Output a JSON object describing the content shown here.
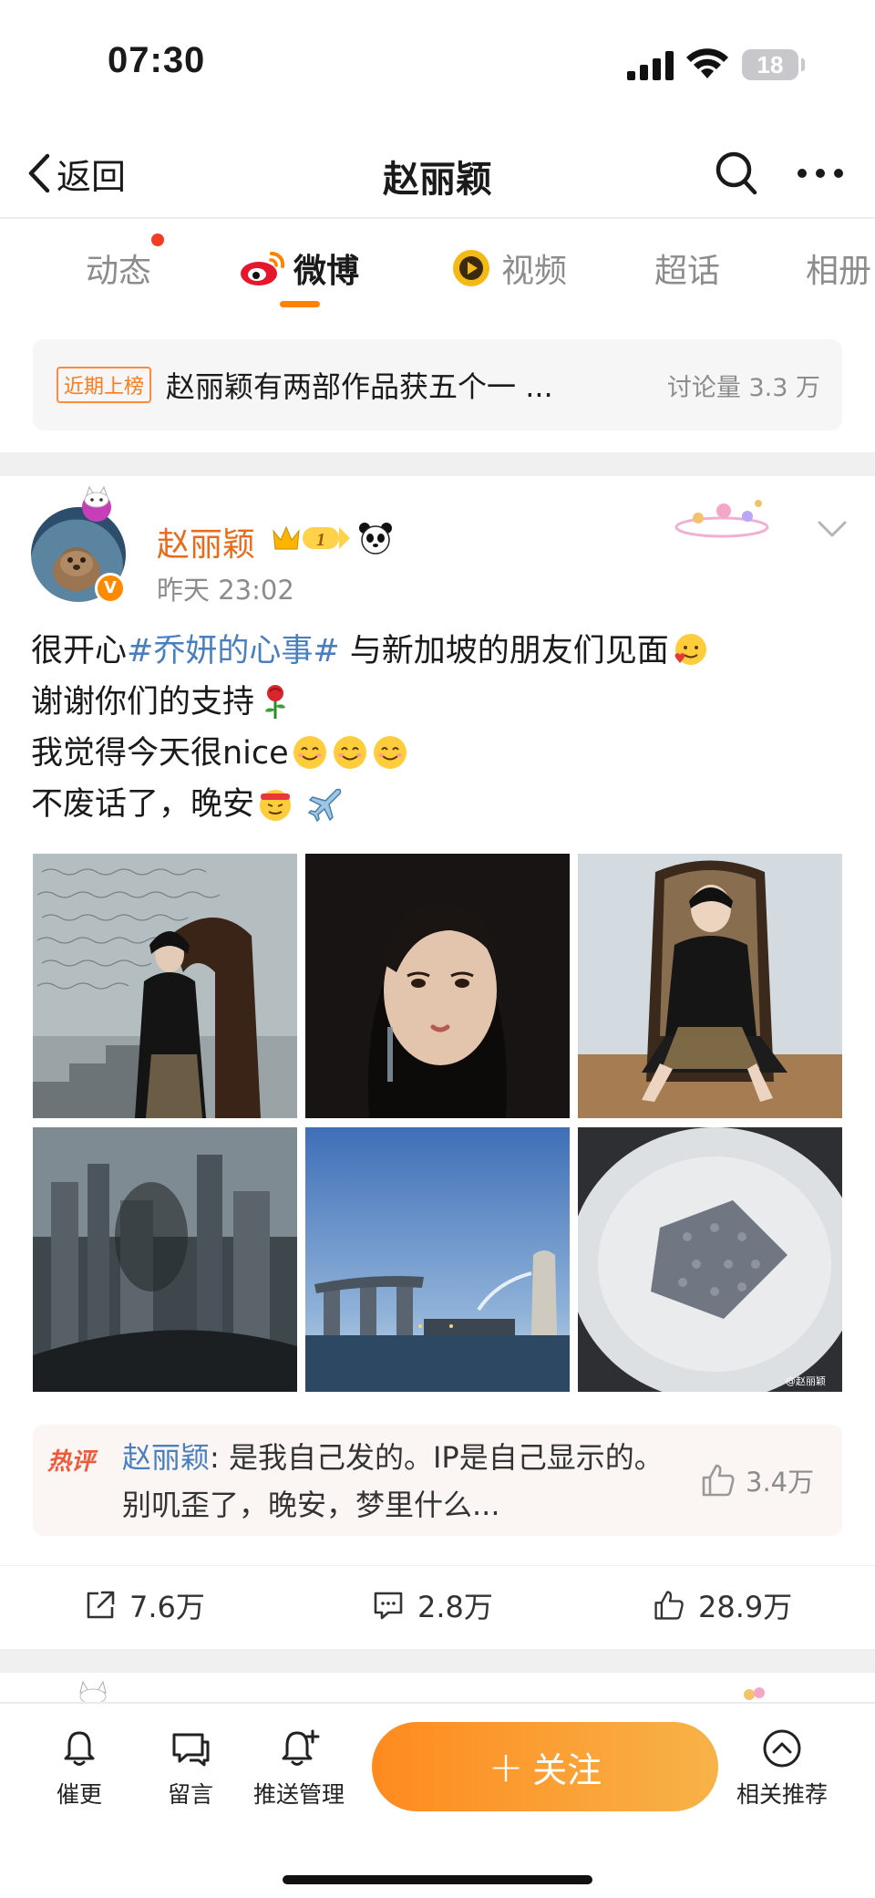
{
  "status_bar": {
    "time": "07:30",
    "battery": "18"
  },
  "nav": {
    "back_label": "返回",
    "title": "赵丽颖"
  },
  "tabs": [
    {
      "label": "动态"
    },
    {
      "label": "微博"
    },
    {
      "label": "视频"
    },
    {
      "label": "超话"
    },
    {
      "label": "相册"
    }
  ],
  "rank_banner": {
    "tag": "近期上榜",
    "text": "赵丽颖有两部作品获五个一 ...",
    "count": "讨论量 3.3 万"
  },
  "post": {
    "author": "赵丽颖",
    "member_level": "1",
    "verified_mark": "V",
    "time": "昨天 23:02",
    "lines": [
      {
        "before": "很开心",
        "topic": "#乔妍的心事#",
        "after": " 与新加坡的朋友们见面"
      },
      {
        "text": "谢谢你们的支持"
      },
      {
        "text": "我觉得今天很nice"
      },
      {
        "text": "不废话了，晚安"
      }
    ],
    "photos": [
      {
        "name": "photo-script-wall-stairs"
      },
      {
        "name": "photo-portrait-closeup"
      },
      {
        "name": "photo-rattan-chair"
      },
      {
        "name": "photo-city-window"
      },
      {
        "name": "photo-marina-bay"
      },
      {
        "name": "photo-dessert-plate"
      }
    ],
    "watermark": "@赵丽颖",
    "hot_comment": {
      "tag": "热评",
      "author": "赵丽颖",
      "text": ": 是我自己发的。IP是自己显示的。别叽歪了，晚安，梦里什么...",
      "likes": "3.4万"
    },
    "actions": {
      "reposts": "7.6万",
      "comments": "2.8万",
      "likes": "28.9万"
    }
  },
  "bottom_bar": {
    "update": "催更",
    "message": "留言",
    "push": "推送管理",
    "follow": "关注",
    "related": "相关推荐"
  }
}
